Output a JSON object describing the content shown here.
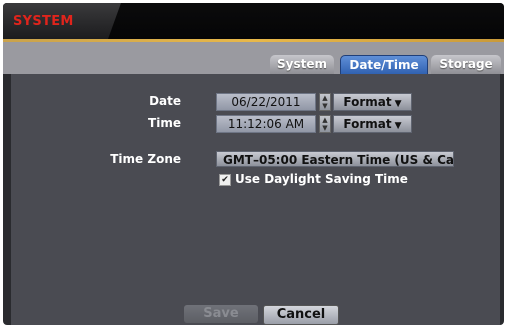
{
  "window": {
    "title": "SYSTEM"
  },
  "tabs": [
    {
      "label": "System",
      "active": false
    },
    {
      "label": "Date/Time",
      "active": true
    },
    {
      "label": "Storage",
      "active": false
    }
  ],
  "form": {
    "date_label": "Date",
    "date_value": "06/22/2011",
    "time_label": "Time",
    "time_value": "11:12:06 AM",
    "format_label": "Format",
    "timezone_label": "Time Zone",
    "timezone_value": "GMT–05:00  Eastern Time (US & Ca",
    "dst_label": "Use Daylight Saving Time",
    "dst_checked": true
  },
  "footer": {
    "save_label": "Save",
    "cancel_label": "Cancel"
  },
  "colors": {
    "title_red": "#e0241c",
    "accent_gold": "#e8b84a",
    "active_tab_blue": "#3b6cc0"
  }
}
